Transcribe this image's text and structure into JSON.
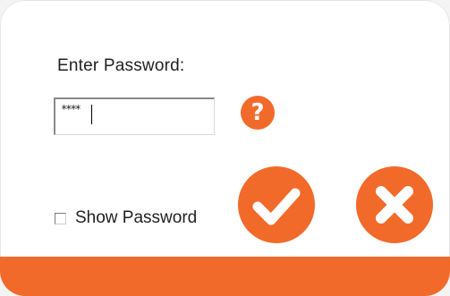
{
  "dialog": {
    "prompt_label": "Enter Password:",
    "password_value": "****",
    "show_password_label": "Show Password",
    "show_password_checked": false
  },
  "icons": {
    "help": "question-mark-icon",
    "ok": "checkmark-icon",
    "cancel": "x-icon",
    "help_glyph": "?"
  },
  "colors": {
    "accent": "#f26a2a",
    "background": "#ffffff",
    "text": "#222222"
  }
}
